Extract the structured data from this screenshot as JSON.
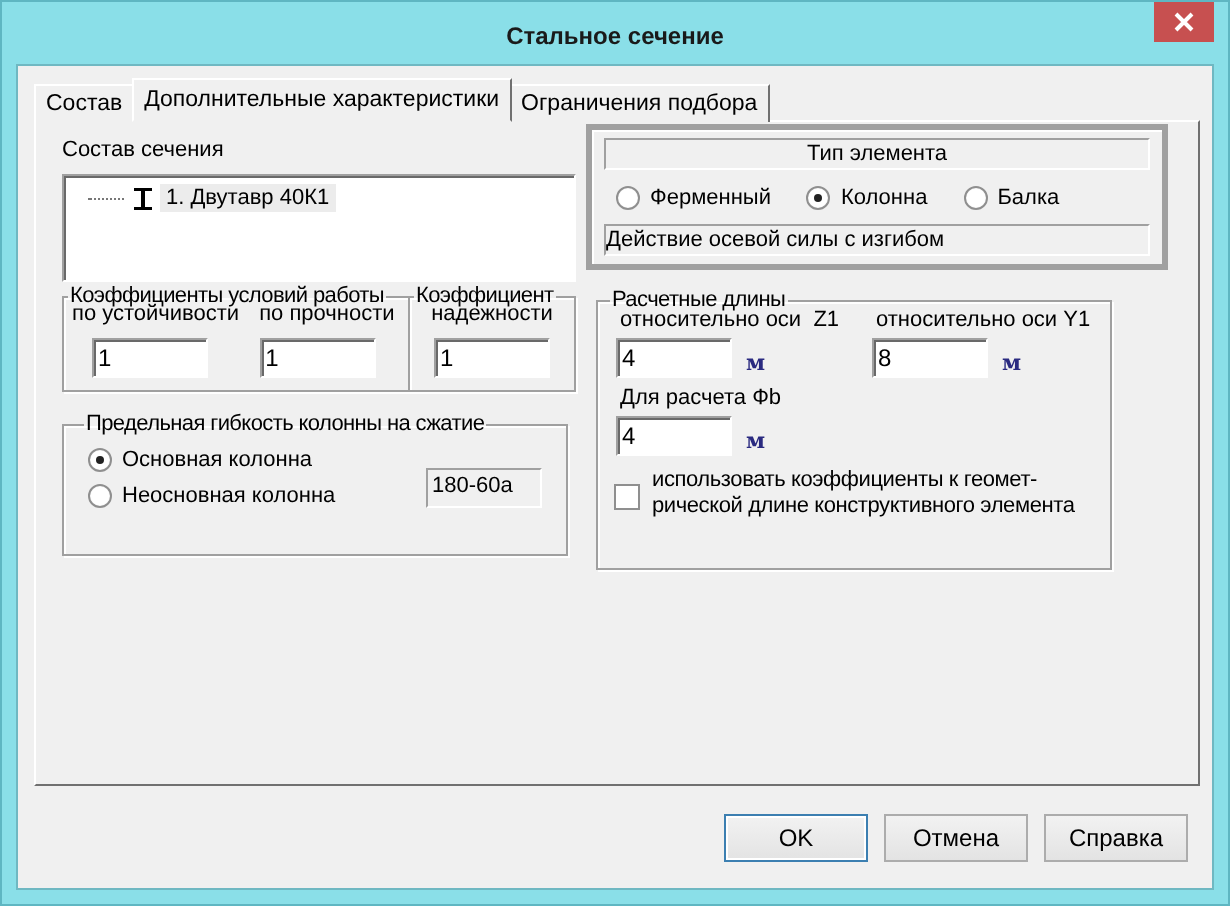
{
  "window": {
    "title": "Стальное сечение"
  },
  "tabs": [
    {
      "label": "Состав",
      "selected": false
    },
    {
      "label": "Дополнительные характеристики",
      "selected": true
    },
    {
      "label": "Ограничения подбора",
      "selected": false
    }
  ],
  "section_composition": {
    "label": "Состав сечения",
    "items": [
      {
        "label": "1. Двутавр 40К1",
        "selected": true
      }
    ]
  },
  "work_coefficients": {
    "title": "Коэффициенты условий работы",
    "fields": [
      {
        "label": "по устойчивости",
        "value": "1"
      },
      {
        "label": "по прочности",
        "value": "1"
      }
    ]
  },
  "reliability": {
    "title": "Коэффициент",
    "label": "надежности",
    "value": "1"
  },
  "flexibility": {
    "title": "Предельная гибкость колонны на сжатие",
    "options": [
      {
        "label": "Основная колонна",
        "selected": true
      },
      {
        "label": "Неосновная колонна",
        "selected": false
      }
    ],
    "formula": "180-60a"
  },
  "element_type": {
    "title": "Тип элемента",
    "options": [
      {
        "label": "Ферменный",
        "selected": false
      },
      {
        "label": "Колонна",
        "selected": true
      },
      {
        "label": "Балка",
        "selected": false
      }
    ],
    "description": "Действие осевой силы с изгибом"
  },
  "lengths": {
    "title": "Расчетные длины",
    "fields": [
      {
        "label": "относительно оси  Z1",
        "value": "4",
        "unit": "м"
      },
      {
        "label": "относительно оси Y1",
        "value": "8",
        "unit": "м"
      },
      {
        "label": "Для расчета Фb",
        "value": "4",
        "unit": "м"
      }
    ],
    "checkbox": {
      "label": "использовать коэффициенты к геомет-\nрической длине конструктивного элемента",
      "checked": false
    }
  },
  "buttons": [
    {
      "label": "OK",
      "default": true
    },
    {
      "label": "Отмена",
      "default": false
    },
    {
      "label": "Справка",
      "default": false
    }
  ]
}
